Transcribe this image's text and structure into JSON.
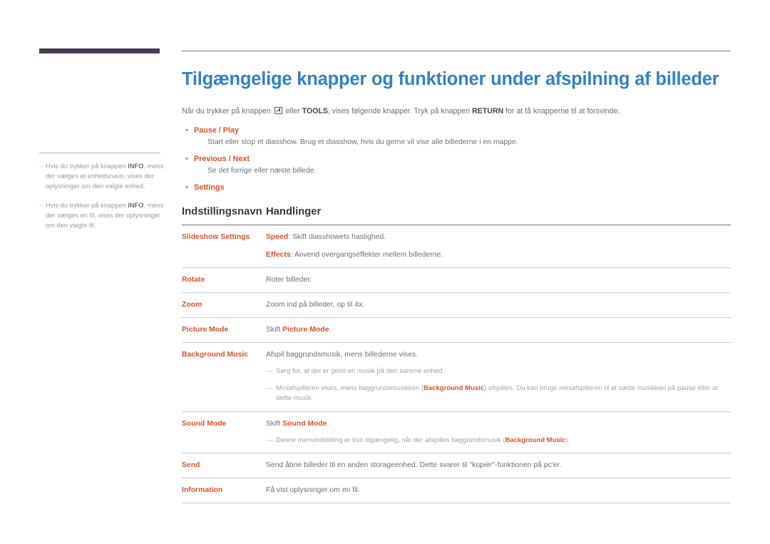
{
  "decor": {
    "bar_color": "#473a56",
    "rule_color": "#7d7d82"
  },
  "colors": {
    "title_blue": "#3282c4",
    "accent_orange": "#d9532c",
    "body_gray": "#6f6f75",
    "note_gray": "#a2a2a9"
  },
  "side_notes": [
    {
      "dash": "–",
      "pre": "Hvis du trykker på knappen ",
      "bold": "INFO",
      "post": ", mens der vælges et enhedsnavn, vises der oplysninger om den valgte enhed."
    },
    {
      "dash": "–",
      "pre": "Hvis du trykker på knappen ",
      "bold": "INFO",
      "post": ", mens der vælges en fil, vises der oplysninger om den valgte fil."
    }
  ],
  "main": {
    "title": "Tilgængelige knapper og funktioner under afspilning af billeder",
    "intro": {
      "part1": "Når du trykker på knappen ",
      "icon": "enter-key-icon",
      "part2": " eller ",
      "bold1": "TOOLS",
      "part3": ", vises følgende knapper. Tryk på knappen ",
      "bold2": "RETURN",
      "part4": " for at få knapperne til at forsvinde."
    },
    "bullets": [
      {
        "dot": "•",
        "title": "Pause / Play",
        "desc": "Start eller stop et diasshow. Brug et diasshow, hvis du gerne vil vise alle billederne i en mappe."
      },
      {
        "dot": "•",
        "title": "Previous / Next",
        "desc": "Se det forrige eller næste billede."
      },
      {
        "dot": "•",
        "title": "Settings",
        "desc": ""
      }
    ],
    "table": {
      "headers": {
        "col1": "Indstillingsnavn",
        "col2": "Handlinger"
      },
      "rows": [
        {
          "name": "Slideshow Settings",
          "lines": [
            {
              "bold_or": "Speed",
              "text": ": Skift diasshowets hastighed."
            },
            {
              "bold_or": "Effects",
              "text": ": Anvend overgangseffekter mellem billederne."
            }
          ],
          "subnotes": []
        },
        {
          "name": "Rotate",
          "lines": [
            {
              "bold_or": "",
              "text": "Roter billeder."
            }
          ],
          "subnotes": []
        },
        {
          "name": "Zoom",
          "lines": [
            {
              "bold_or": "",
              "text": "Zoom ind på billeder, op til 4x."
            }
          ],
          "subnotes": []
        },
        {
          "name": "Picture Mode",
          "lines": [
            {
              "pre": "Skift ",
              "bold_or": "Picture Mode",
              "text": "."
            }
          ],
          "subnotes": []
        },
        {
          "name": "Background Music",
          "lines": [
            {
              "bold_or": "",
              "text": "Afspil baggrundsmusik, mens billederne vises."
            }
          ],
          "subnotes": [
            {
              "dash": "—",
              "pre": "Sørg for, at der er gemt en musik på den samme enhed.",
              "bold": "",
              "post": ""
            },
            {
              "dash": "—",
              "pre": "Miniafspilleren vises, mens baggrundsmusikken (",
              "bold": "Background Music",
              "post": ") afspilles. Du kan bruge miniafspilleren til at sætte musikken på pause eller at skifte musik."
            }
          ]
        },
        {
          "name": "Sound Mode",
          "lines": [
            {
              "pre": "Skift ",
              "bold_or": "Sound Mode",
              "text": "."
            }
          ],
          "subnotes": [
            {
              "dash": "—",
              "pre": "Denne menuindstilling er kun tilgængelig, når der afspilles baggrundsmusik (",
              "bold": "Background Music",
              "post": ")."
            }
          ]
        },
        {
          "name": "Send",
          "lines": [
            {
              "bold_or": "",
              "text": "Send åbne billeder til en anden storageenhed. Dette svarer til \"kopiér\"-funktionen på pc'er."
            }
          ],
          "subnotes": []
        },
        {
          "name": "Information",
          "lines": [
            {
              "bold_or": "",
              "text": "Få vist oplysninger om en fil."
            }
          ],
          "subnotes": []
        }
      ]
    }
  }
}
